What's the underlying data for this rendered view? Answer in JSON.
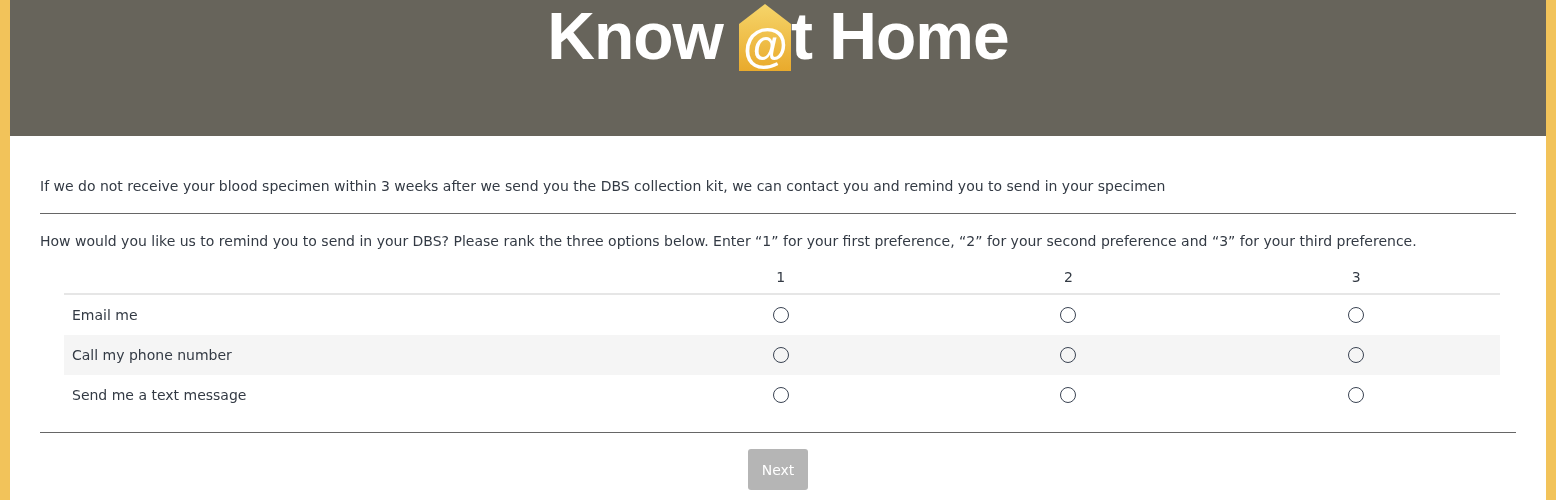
{
  "header": {
    "logo": {
      "before": "Know",
      "mark": "@",
      "after": "t Home"
    }
  },
  "intro": "If we do not receive your blood specimen within 3 weeks after we send you the DBS collection kit, we can contact you and remind you to send in your specimen",
  "question": "How would you like us to remind you to send in your DBS? Please rank the three options below. Enter “1” for your first preference, “2” for your second preference and “3” for your third preference.",
  "table": {
    "columns": [
      "1",
      "2",
      "3"
    ],
    "rows": [
      {
        "label": "Email me",
        "options": [
          {
            "selected": false
          },
          {
            "selected": false
          },
          {
            "selected": false
          }
        ]
      },
      {
        "label": "Call my phone number",
        "options": [
          {
            "selected": false
          },
          {
            "selected": false
          },
          {
            "selected": false
          }
        ]
      },
      {
        "label": "Send me a text message",
        "options": [
          {
            "selected": false
          },
          {
            "selected": false
          },
          {
            "selected": false
          }
        ]
      }
    ]
  },
  "next_button": {
    "label": "Next",
    "disabled": true
  }
}
